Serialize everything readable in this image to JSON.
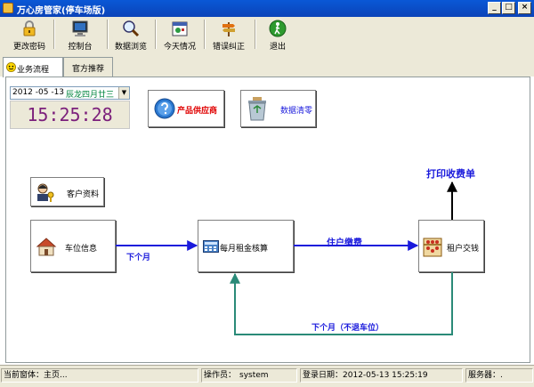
{
  "window": {
    "title": "万心房管家(停车场版)",
    "controls": {
      "minimize": "_",
      "maximize": "□",
      "close": "×"
    }
  },
  "toolbar": {
    "items": [
      {
        "label": "更改密码",
        "icon": "lock-icon"
      },
      {
        "label": "控制台",
        "icon": "monitor-icon"
      },
      {
        "label": "数据浏览",
        "icon": "magnifier-icon"
      },
      {
        "label": "今天情况",
        "icon": "calendar-icon"
      },
      {
        "label": "错误纠正",
        "icon": "signpost-icon"
      },
      {
        "label": "退出",
        "icon": "exit-icon"
      }
    ]
  },
  "tabs": [
    {
      "label": "业务流程",
      "active": true
    },
    {
      "label": "官方推荐",
      "active": false
    }
  ],
  "date_picker": {
    "date": "2012 -05 -13",
    "lunar": "辰龙四月廿三"
  },
  "clock": {
    "time": "15:25:28"
  },
  "buttons": {
    "supplier": "产品供应商",
    "clear_data": "数据清零",
    "customer": "客户资料",
    "parking": "车位信息",
    "monthly_rent": "每月租金核算",
    "tenant_pay": "租户交钱"
  },
  "flow": {
    "next_month": "下个月",
    "resident_payment": "住户缴费",
    "print_receipt": "打印收费单",
    "next_month_no_refund": "下个月（不退车位）"
  },
  "status": {
    "window_label": "当前窗体：",
    "window_value": "主页...",
    "operator_label": "操作员：",
    "operator_value": "system",
    "login_label": "登录日期：",
    "login_value": "2012-05-13 15:25:19",
    "server_label": "服务器：",
    "server_value": "."
  },
  "colors": {
    "flow_blue": "#1a1adc",
    "flow_teal": "#2a8a78",
    "clock_purple": "#7b1f7b",
    "supplier_red": "#e00000",
    "lunar_green": "#00853e"
  }
}
